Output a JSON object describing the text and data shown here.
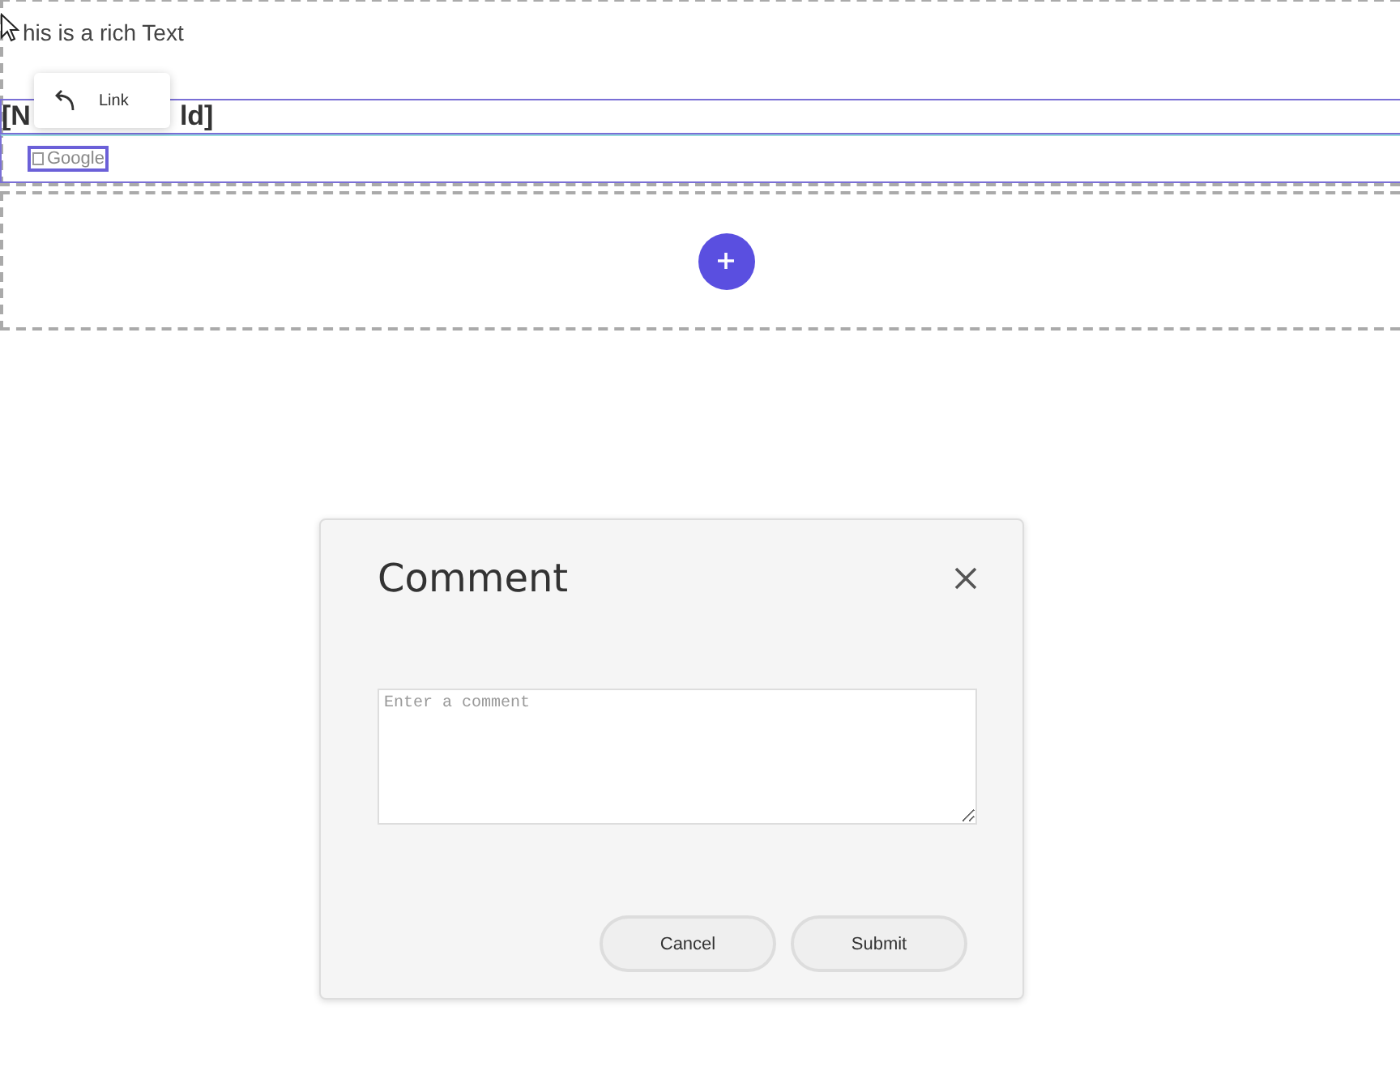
{
  "rich_text": "his is a rich Text",
  "heading": {
    "start": "[N",
    "end": "ld]"
  },
  "link_popup": {
    "label": "Link"
  },
  "link": {
    "label": "Google"
  },
  "dialog": {
    "title": "Comment",
    "comment_field": {
      "placeholder": "Enter a comment"
    },
    "buttons": [
      "Cancel",
      "Submit"
    ]
  }
}
